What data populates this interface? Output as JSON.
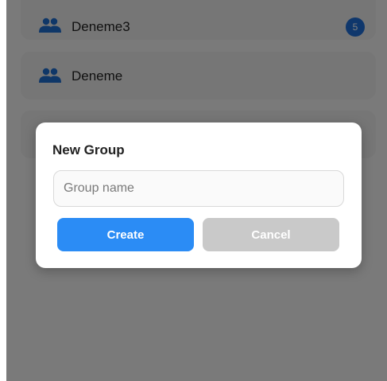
{
  "groups": [
    {
      "name": "Deneme3",
      "badge": "5",
      "icon": "group-icon"
    },
    {
      "name": "Deneme",
      "icon": "group-icon"
    }
  ],
  "dialog": {
    "title": "New Group",
    "input_placeholder": "Group name",
    "input_value": "",
    "create_label": "Create",
    "cancel_label": "Cancel"
  },
  "colors": {
    "primary": "#2b8cf5",
    "badge": "#1e6fd9",
    "disabled": "#c9c9c9"
  }
}
